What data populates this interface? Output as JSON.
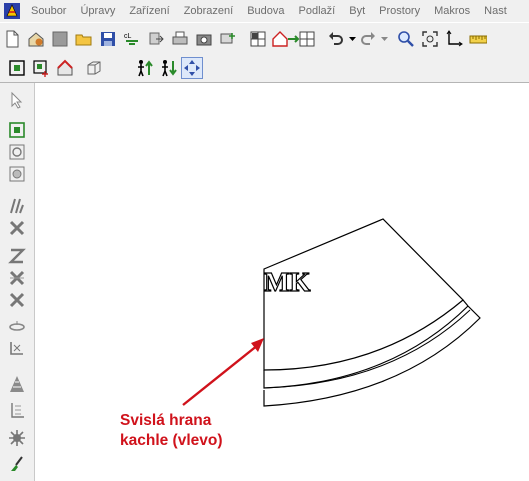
{
  "menubar": {
    "items": [
      "Soubor",
      "Úpravy",
      "Zařízení",
      "Zobrazení",
      "Budova",
      "Podlaží",
      "Byt",
      "Prostory",
      "Makros",
      "Nast"
    ]
  },
  "toolbar1": {
    "icons": [
      "new-document-icon",
      "house-template-icon",
      "gray-box-icon",
      "open-folder-icon",
      "save-icon",
      "calculate-icon",
      "export-icon",
      "print-icon",
      "camera-icon",
      "monitor-add-icon",
      "layout-icon",
      "house-transfer-icon",
      "grid-icon",
      "undo-icon",
      "redo-icon",
      "zoom-icon",
      "zoom-window-icon",
      "axis-icon",
      "ruler-icon"
    ]
  },
  "toolbar2": {
    "icons": [
      "select-frame-icon",
      "select-add-icon",
      "house-red-icon",
      "cube-icon",
      "person-up-icon",
      "person-down-icon",
      "move-arrows-icon"
    ]
  },
  "left_tools": {
    "icons": [
      "pointer-icon",
      "frame-select-icon",
      "rotate-select-icon",
      "circle-select-icon",
      "tool-a-icon",
      "cross-a-icon",
      "tool-z-icon",
      "cross-b-icon",
      "cross-c-icon",
      "ring-icon",
      "corner-icon",
      "hatch-icon",
      "stairs-icon",
      "gear-icon",
      "brush-icon"
    ]
  },
  "canvas": {
    "shape_label": "MK",
    "annotation_line1": "Svislá hrana",
    "annotation_line2": "kachle (vlevo)",
    "annotation_color": "#d0121b"
  }
}
